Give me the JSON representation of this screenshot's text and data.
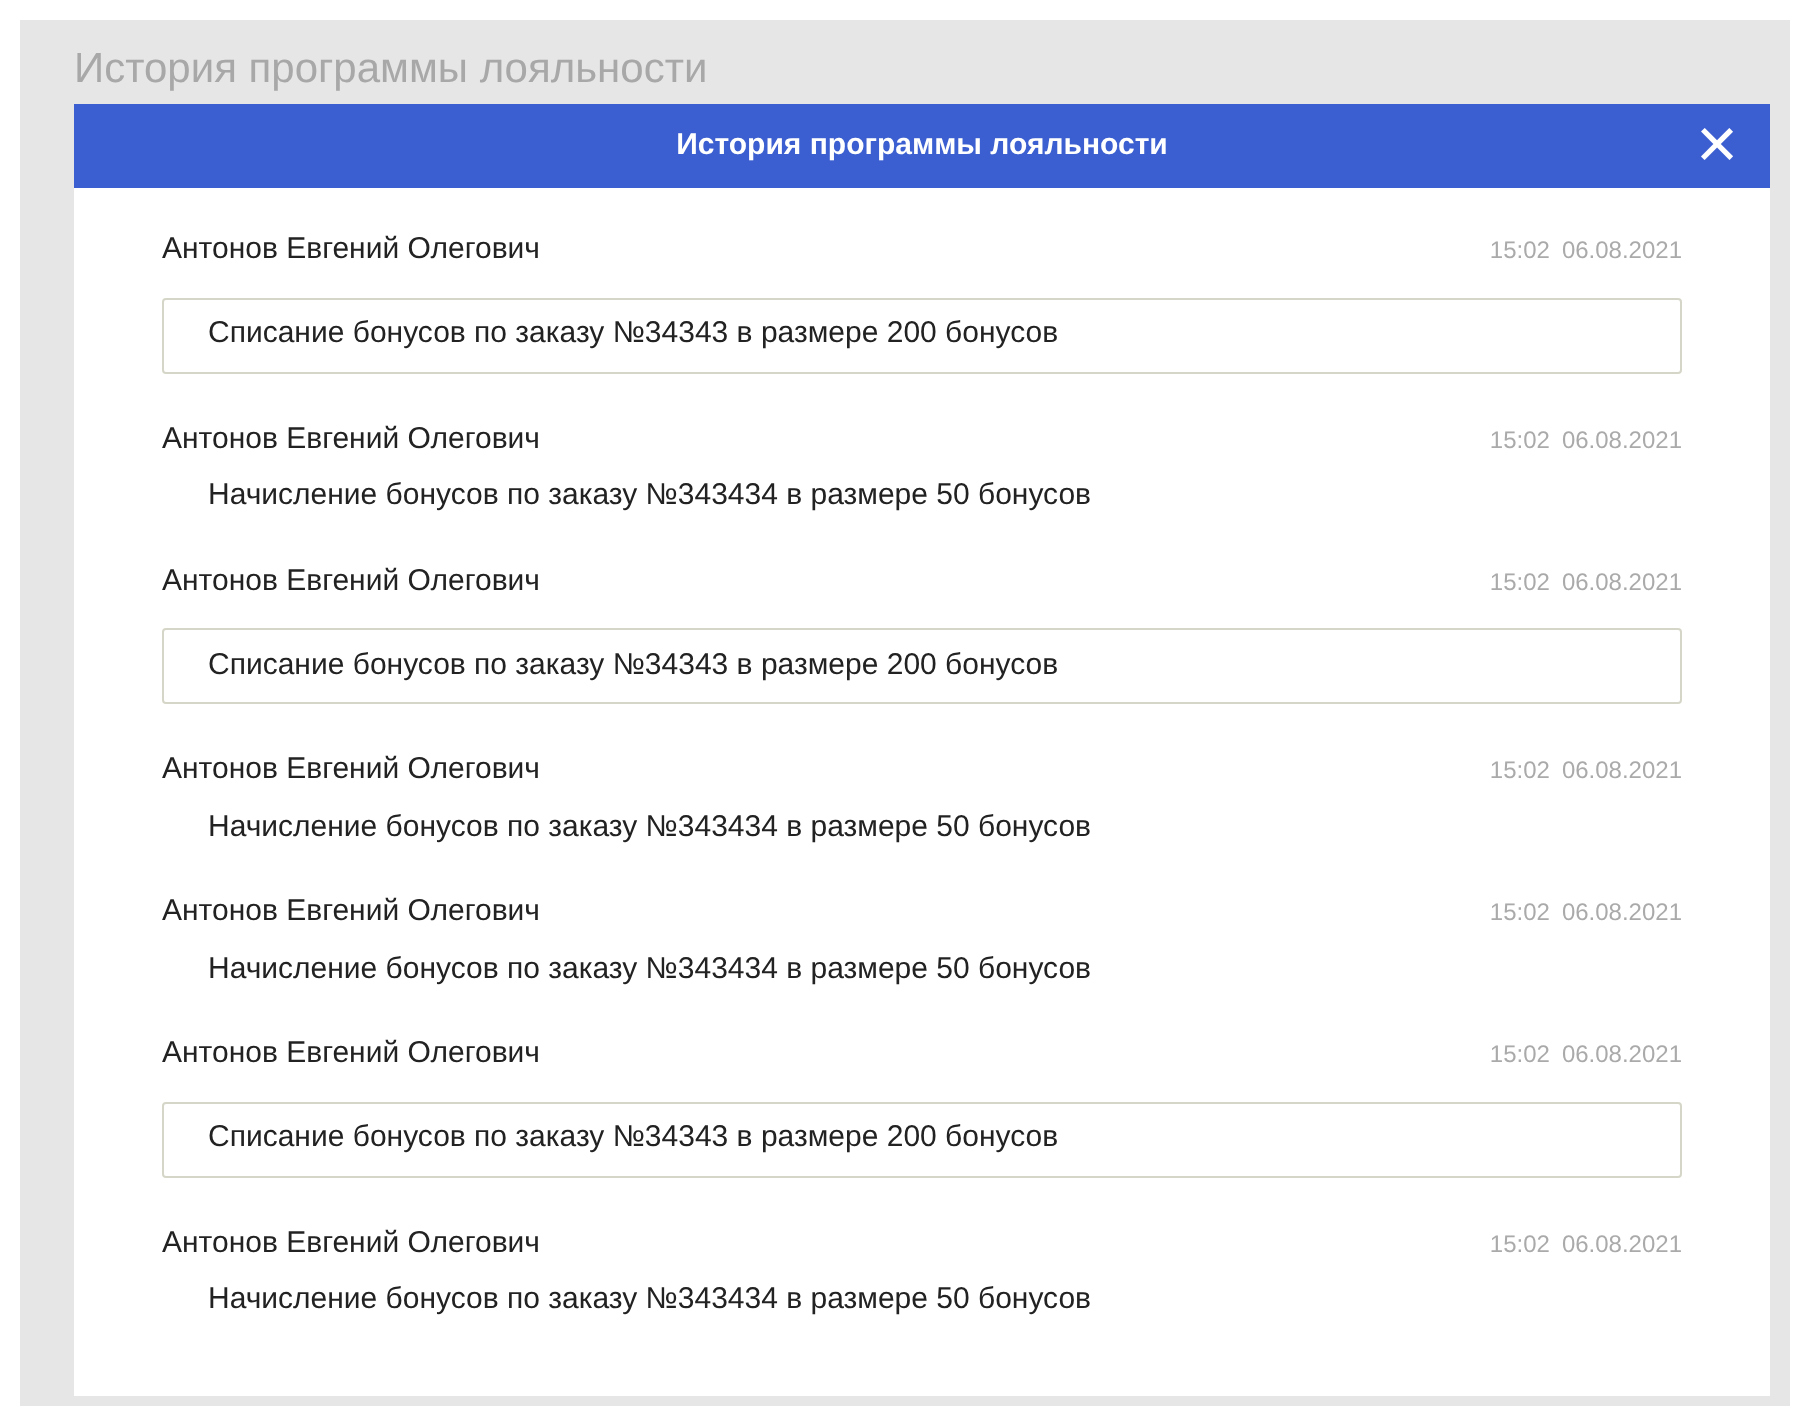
{
  "page_title": "История программы лояльности",
  "dialog": {
    "title": "История программы лояльности",
    "close": "×"
  },
  "entries": [
    {
      "kind": "debit",
      "author": "Антонов Евгений Олегович",
      "time": "15:02",
      "date": "06.08.2021",
      "text": "Списание бонусов по заказу №34343 в размере 200 бонусов"
    },
    {
      "kind": "credit",
      "author": "Антонов Евгений Олегович",
      "time": "15:02",
      "date": "06.08.2021",
      "text": "Начисление бонусов по заказу №343434 в размере 50 бонусов"
    },
    {
      "kind": "debit",
      "author": "Антонов Евгений Олегович",
      "time": "15:02",
      "date": "06.08.2021",
      "text": "Списание бонусов по заказу №34343 в размере 200 бонусов"
    },
    {
      "kind": "credit",
      "author": "Антонов Евгений Олегович",
      "time": "15:02",
      "date": "06.08.2021",
      "text": "Начисление бонусов по заказу №343434 в размере 50 бонусов"
    },
    {
      "kind": "credit",
      "author": "Антонов Евгений Олегович",
      "time": "15:02",
      "date": "06.08.2021",
      "text": "Начисление бонусов по заказу №343434 в размере 50 бонусов"
    },
    {
      "kind": "debit",
      "author": "Антонов Евгений Олегович",
      "time": "15:02",
      "date": "06.08.2021",
      "text": "Списание бонусов по заказу №34343 в размере 200 бонусов"
    },
    {
      "kind": "credit",
      "author": "Антонов Евгений Олегович",
      "time": "15:02",
      "date": "06.08.2021",
      "text": "Начисление бонусов по заказу №343434 в размере 50 бонусов"
    }
  ]
}
